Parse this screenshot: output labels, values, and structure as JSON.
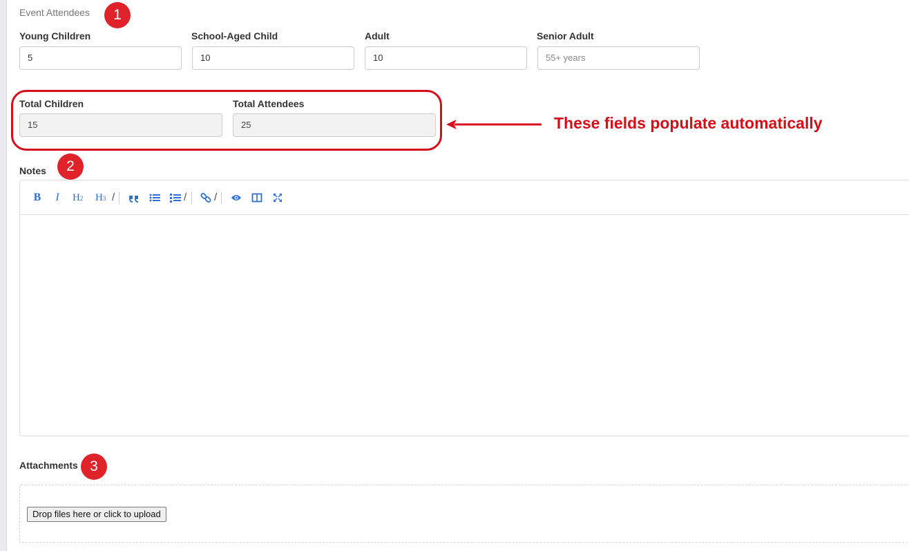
{
  "sections": {
    "event_attendees": "Event Attendees",
    "notes": "Notes",
    "attachments": "Attachments"
  },
  "fields": {
    "young_children": {
      "label": "Young Children",
      "value": "5",
      "placeholder": ""
    },
    "school_aged_child": {
      "label": "School-Aged Child",
      "value": "10",
      "placeholder": ""
    },
    "adult": {
      "label": "Adult",
      "value": "10",
      "placeholder": ""
    },
    "senior_adult": {
      "label": "Senior Adult",
      "value": "",
      "placeholder": "55+ years"
    },
    "total_children": {
      "label": "Total Children",
      "value": "15"
    },
    "total_attendees": {
      "label": "Total Attendees",
      "value": "25"
    }
  },
  "annotations": {
    "badges": [
      "1",
      "2",
      "3"
    ],
    "callout_text": "These fields populate automatically",
    "accent_color": "#d60d16"
  },
  "editor_toolbar": {
    "items": [
      "bold-icon",
      "italic-icon",
      "heading-2-icon",
      "heading-3-icon",
      "quote-icon",
      "unordered-list-icon",
      "ordered-list-icon",
      "link-icon",
      "preview-icon",
      "side-by-side-icon",
      "fullscreen-icon"
    ],
    "bold": "B",
    "italic": "I",
    "h2": "H",
    "h2_sub": "2",
    "h3": "H",
    "h3_sub": "3",
    "slash": "/",
    "icon_color": "#2d6fd4"
  },
  "upload": {
    "button_label": "Drop files here or click to upload"
  }
}
